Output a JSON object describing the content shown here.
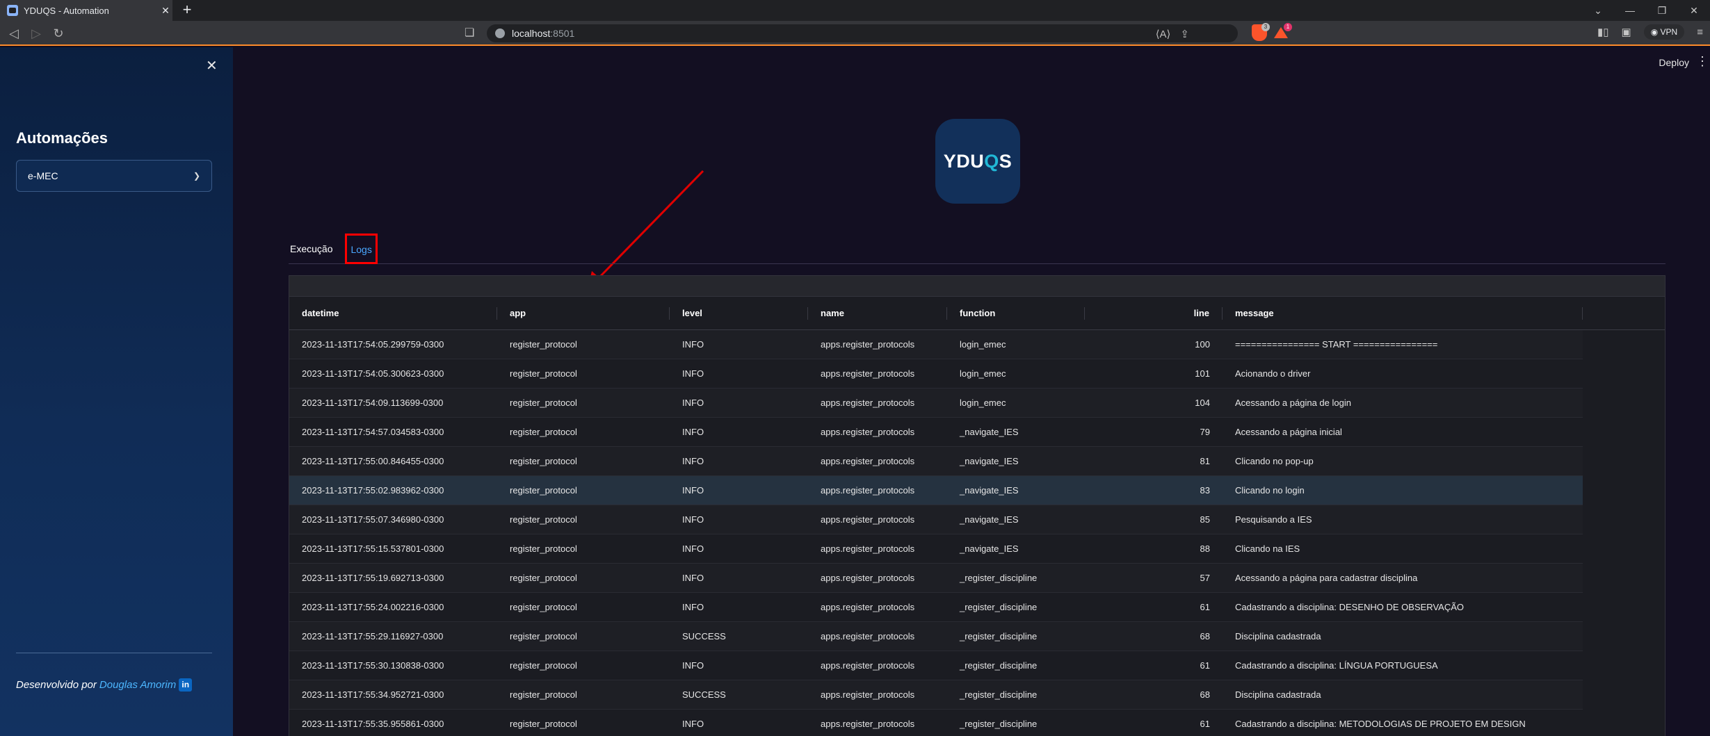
{
  "browser": {
    "tab_title": "YDUQS - Automation",
    "url_host": "localhost",
    "url_port": ":8501",
    "vpn_label": "VPN",
    "brave_shield_count": "3",
    "brave_rewards_count": "1"
  },
  "sidebar": {
    "title": "Automações",
    "select_value": "e-MEC",
    "footer_prefix": "Desenvolvido por",
    "footer_author": "Douglas Amorim",
    "linkedin_glyph": "in"
  },
  "header": {
    "deploy_label": "Deploy"
  },
  "logo": {
    "text_left": "YDU",
    "text_q": "Q",
    "text_right": "S"
  },
  "tabs": [
    {
      "label": "Execução"
    },
    {
      "label": "Logs"
    }
  ],
  "table": {
    "columns": [
      "datetime",
      "app",
      "level",
      "name",
      "function",
      "line",
      "message"
    ],
    "rows": [
      [
        "2023-11-13T17:54:05.299759-0300",
        "register_protocol",
        "INFO",
        "apps.register_protocols",
        "login_emec",
        "100",
        "================ START ================"
      ],
      [
        "2023-11-13T17:54:05.300623-0300",
        "register_protocol",
        "INFO",
        "apps.register_protocols",
        "login_emec",
        "101",
        "Acionando o driver"
      ],
      [
        "2023-11-13T17:54:09.113699-0300",
        "register_protocol",
        "INFO",
        "apps.register_protocols",
        "login_emec",
        "104",
        "Acessando a página de login"
      ],
      [
        "2023-11-13T17:54:57.034583-0300",
        "register_protocol",
        "INFO",
        "apps.register_protocols",
        "_navigate_IES",
        "79",
        "Acessando a página inicial"
      ],
      [
        "2023-11-13T17:55:00.846455-0300",
        "register_protocol",
        "INFO",
        "apps.register_protocols",
        "_navigate_IES",
        "81",
        "Clicando no pop-up"
      ],
      [
        "2023-11-13T17:55:02.983962-0300",
        "register_protocol",
        "INFO",
        "apps.register_protocols",
        "_navigate_IES",
        "83",
        "Clicando no login"
      ],
      [
        "2023-11-13T17:55:07.346980-0300",
        "register_protocol",
        "INFO",
        "apps.register_protocols",
        "_navigate_IES",
        "85",
        "Pesquisando a IES"
      ],
      [
        "2023-11-13T17:55:15.537801-0300",
        "register_protocol",
        "INFO",
        "apps.register_protocols",
        "_navigate_IES",
        "88",
        "Clicando na IES"
      ],
      [
        "2023-11-13T17:55:19.692713-0300",
        "register_protocol",
        "INFO",
        "apps.register_protocols",
        "_register_discipline",
        "57",
        "Acessando a página para cadastrar disciplina"
      ],
      [
        "2023-11-13T17:55:24.002216-0300",
        "register_protocol",
        "INFO",
        "apps.register_protocols",
        "_register_discipline",
        "61",
        "Cadastrando a disciplina: DESENHO DE OBSERVAÇÃO"
      ],
      [
        "2023-11-13T17:55:29.116927-0300",
        "register_protocol",
        "SUCCESS",
        "apps.register_protocols",
        "_register_discipline",
        "68",
        "Disciplina cadastrada"
      ],
      [
        "2023-11-13T17:55:30.130838-0300",
        "register_protocol",
        "INFO",
        "apps.register_protocols",
        "_register_discipline",
        "61",
        "Cadastrando a disciplina: LÍNGUA PORTUGUESA"
      ],
      [
        "2023-11-13T17:55:34.952721-0300",
        "register_protocol",
        "SUCCESS",
        "apps.register_protocols",
        "_register_discipline",
        "68",
        "Disciplina cadastrada"
      ],
      [
        "2023-11-13T17:55:35.955861-0300",
        "register_protocol",
        "INFO",
        "apps.register_protocols",
        "_register_discipline",
        "61",
        "Cadastrando a disciplina: METODOLOGIAS DE PROJETO EM DESIGN"
      ]
    ]
  }
}
